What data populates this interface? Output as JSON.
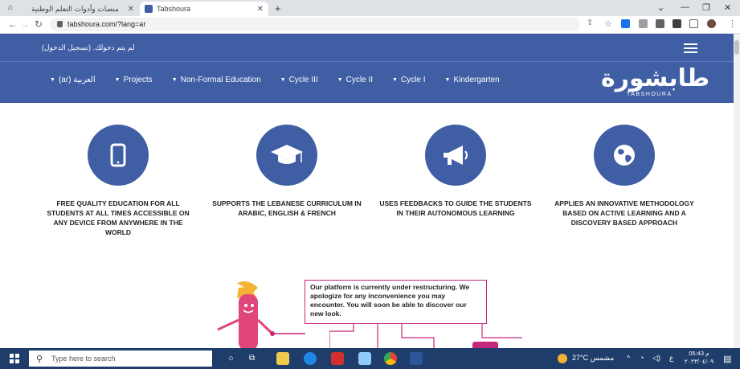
{
  "browser": {
    "tabs": [
      {
        "title": "منصات وأدوات التعلم الوطنية"
      },
      {
        "title": "Tabshoura"
      }
    ],
    "url": "tabshoura.com/?lang=ar",
    "new_tab_symbol": "+",
    "close_symbol": "✕",
    "window_controls": [
      "⌄",
      "—",
      "❐",
      "✕"
    ]
  },
  "site": {
    "login_text": "لم يتم دخولك. (تسجيل الدخول)",
    "menu": [
      {
        "label": "(ar) العربية"
      },
      {
        "label": "Projects"
      },
      {
        "label": "Non-Formal Education"
      },
      {
        "label": "Cycle III"
      },
      {
        "label": "Cycle II"
      },
      {
        "label": "Cycle I"
      },
      {
        "label": "Kindergarten"
      }
    ],
    "logo_ar": "طابشورة",
    "logo_en": "TABSHOURA",
    "accent": "#3f5ea4",
    "features": [
      {
        "icon": "tablet-icon",
        "text": "FREE QUALITY EDUCATION FOR ALL STUDENTS AT ALL TIMES ACCESSIBLE ON ANY DEVICE FROM ANYWHERE IN THE WORLD"
      },
      {
        "icon": "graduation-cap-icon",
        "text": "SUPPORTS THE LEBANESE CURRICULUM IN ARABIC, ENGLISH & FRENCH"
      },
      {
        "icon": "megaphone-icon",
        "text": "USES FEEDBACKS TO GUIDE THE STUDENTS IN THEIR AUTONOMOUS LEARNING"
      },
      {
        "icon": "globe-icon",
        "text": "APPLIES AN INNOVATIVE METHODOLOGY BASED ON ACTIVE LEARNING AND A DISCOVERY BASED APPROACH"
      }
    ],
    "notice": "Our platform is currently under restructuring. We apologize for any inconvenience you may encounter. You will soon be able to discover our new look."
  },
  "taskbar": {
    "search_placeholder": "Type here to search",
    "weather": "27°C  مشمس",
    "time": "05:43 م",
    "date": "٢٠٢٣/٠٤/٠٩",
    "lang": "ع"
  }
}
